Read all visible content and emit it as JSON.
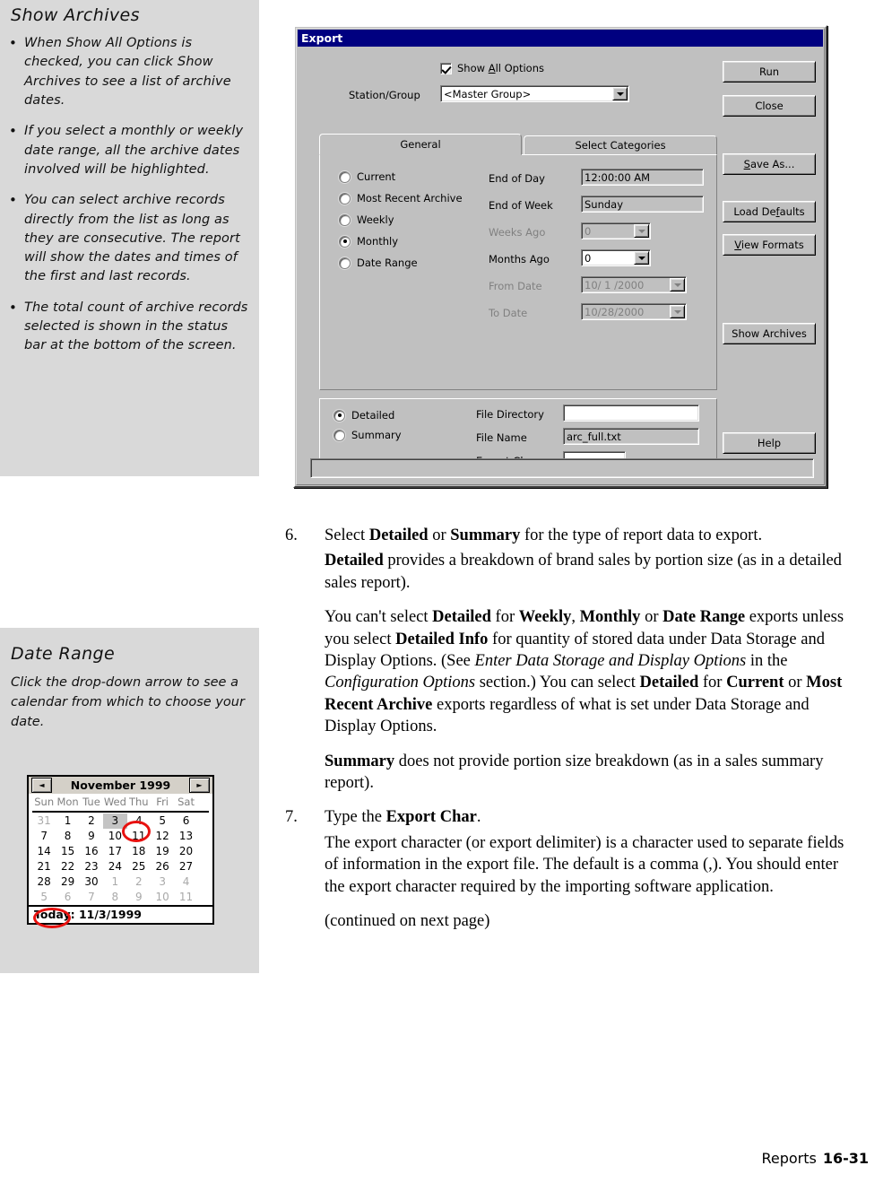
{
  "sidebar": {
    "archives": {
      "heading": "Show Archives",
      "bullets": [
        "When Show All Options is checked, you can click Show Archives to see a list of archive dates.",
        "If you select a monthly or weekly date range, all the archive dates involved will be highlighted.",
        "You can select archive records directly from the list as long as they are consecutive. The report will show the dates and times of the first and last records.",
        "The total count of archive records selected is shown in the status bar at the bottom of the screen."
      ]
    },
    "date_range": {
      "heading": "Date Range",
      "text": "Click the drop-down arrow to see a calendar from which to choose your date."
    }
  },
  "calendar": {
    "prev_label": "◄",
    "next_label": "►",
    "title": "November 1999",
    "day_names": [
      "Sun",
      "Mon",
      "Tue",
      "Wed",
      "Thu",
      "Fri",
      "Sat"
    ],
    "weeks": [
      [
        {
          "d": "31",
          "dim": true
        },
        {
          "d": "1"
        },
        {
          "d": "2"
        },
        {
          "d": "3",
          "sel": true
        },
        {
          "d": "4"
        },
        {
          "d": "5"
        },
        {
          "d": "6"
        }
      ],
      [
        {
          "d": "7"
        },
        {
          "d": "8"
        },
        {
          "d": "9"
        },
        {
          "d": "10"
        },
        {
          "d": "11"
        },
        {
          "d": "12"
        },
        {
          "d": "13"
        }
      ],
      [
        {
          "d": "14"
        },
        {
          "d": "15"
        },
        {
          "d": "16"
        },
        {
          "d": "17"
        },
        {
          "d": "18"
        },
        {
          "d": "19"
        },
        {
          "d": "20"
        }
      ],
      [
        {
          "d": "21"
        },
        {
          "d": "22"
        },
        {
          "d": "23"
        },
        {
          "d": "24"
        },
        {
          "d": "25"
        },
        {
          "d": "26"
        },
        {
          "d": "27"
        }
      ],
      [
        {
          "d": "28"
        },
        {
          "d": "29"
        },
        {
          "d": "30"
        },
        {
          "d": "1",
          "dim": true
        },
        {
          "d": "2",
          "dim": true
        },
        {
          "d": "3",
          "dim": true
        },
        {
          "d": "4",
          "dim": true
        }
      ],
      [
        {
          "d": "5",
          "dim": true
        },
        {
          "d": "6",
          "dim": true
        },
        {
          "d": "7",
          "dim": true
        },
        {
          "d": "8",
          "dim": true
        },
        {
          "d": "9",
          "dim": true
        },
        {
          "d": "10",
          "dim": true
        },
        {
          "d": "11",
          "dim": true
        }
      ]
    ],
    "today": "Today: 11/3/1999",
    "annotation_color": "#e8110f"
  },
  "dialog": {
    "title": "Export",
    "titlebar_color": "#000080",
    "face_color": "#c0c0c0",
    "show_all_options": {
      "label": "Show All Options",
      "accel": "A",
      "checked": true
    },
    "station_group": {
      "label": "Station/Group",
      "value": "<Master Group>"
    },
    "tabs": [
      {
        "label": "General",
        "active": true
      },
      {
        "label": "Select Categories",
        "active": false
      }
    ],
    "range_options": [
      {
        "label": "Current",
        "selected": false
      },
      {
        "label": "Most Recent Archive",
        "selected": false
      },
      {
        "label": "Weekly",
        "selected": false
      },
      {
        "label": "Monthly",
        "selected": true
      },
      {
        "label": "Date Range",
        "selected": false
      }
    ],
    "fields": [
      {
        "label": "End of Day",
        "value": "12:00:00 AM",
        "disabled": false,
        "dropdown": false
      },
      {
        "label": "End of Week",
        "value": "Sunday",
        "disabled": false,
        "dropdown": false
      },
      {
        "label": "Weeks Ago",
        "value": "0",
        "disabled": true,
        "dropdown": true
      },
      {
        "label": "Months Ago",
        "value": "0",
        "disabled": false,
        "dropdown": true,
        "white": true
      },
      {
        "label": "From Date",
        "value": "10/ 1 /2000",
        "disabled": true,
        "dropdown": true
      },
      {
        "label": "To Date",
        "value": "10/28/2000",
        "disabled": true,
        "dropdown": true
      }
    ],
    "report_type": [
      {
        "label": "Detailed",
        "selected": true
      },
      {
        "label": "Summary",
        "selected": false
      }
    ],
    "file_fields": [
      {
        "label": "File Directory",
        "value": ""
      },
      {
        "label": "File Name",
        "value": "arc_full.txt"
      },
      {
        "label": "Export Char",
        "value": ",",
        "white": true,
        "short": true
      }
    ],
    "buttons": [
      {
        "label": "Run",
        "accel": ""
      },
      {
        "label": "Close",
        "accel": ""
      },
      {
        "label": "Save As...",
        "accel": "S"
      },
      {
        "label": "Load Defaults",
        "accel": "f"
      },
      {
        "label": "View Formats",
        "accel": "V"
      },
      {
        "label": "Show Archives",
        "accel": ""
      },
      {
        "label": "Help",
        "accel": ""
      }
    ]
  },
  "content": {
    "step6": {
      "num": "6.",
      "text_html": "Select <b>Detailed</b> or <b>Summary</b> for the type of report data to export."
    },
    "p1_html": "<b>Detailed</b> provides a breakdown of brand sales by portion size (as in a detailed sales report).",
    "p2_html": "You can't select <b>Detailed</b> for <b>Weekly</b>, <b>Monthly</b> or <b>Date Range</b> exports unless you select <b>Detailed Info</b> for quantity of stored data under Data Storage and Display Options. (See <i>Enter Data Storage and Display Options</i> in the <i>Configuration Options</i> section.) You can select <b>Detailed</b> for <b>Current</b> or <b>Most Recent Archive</b> exports regardless of what is set under Data Storage and Display Options.",
    "p3_html": "<b>Summary</b> does not provide portion size breakdown (as in a sales summary report).",
    "step7": {
      "num": "7.",
      "text_html": "Type the <b>Export Char</b>."
    },
    "p4_html": "The export character (or export delimiter) is a character used to separate fields of information in the export file. The default is a comma (,). You should enter the export character required by the importing software application.",
    "p5_html": "(continued on next page)"
  },
  "footer": {
    "section": "Reports",
    "page": "16-31"
  }
}
